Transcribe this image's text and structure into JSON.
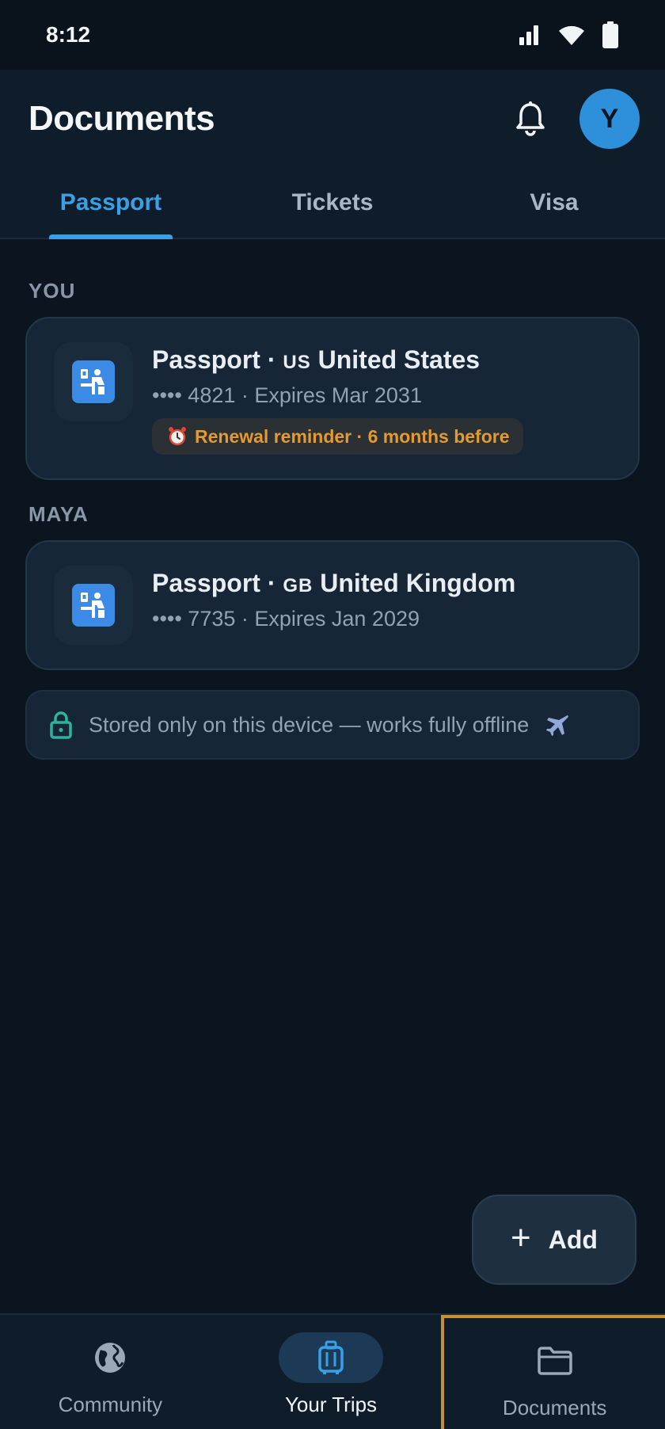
{
  "status_bar": {
    "time": "8:12",
    "icons": [
      "signal-icon",
      "wifi-icon",
      "battery-icon"
    ]
  },
  "header": {
    "title": "Documents",
    "notifications_icon": "bell-icon",
    "avatar_initial": "Y"
  },
  "tabs": [
    {
      "label": "Passport",
      "active": true
    },
    {
      "label": "Tickets",
      "active": false
    },
    {
      "label": "Visa",
      "active": false
    }
  ],
  "sections": [
    {
      "label": "YOU",
      "document": {
        "title_prefix": "Passport ·",
        "country_code": "US",
        "country": "United States",
        "subtitle": "•••• 4821 · Expires Mar 2031",
        "reminder": "Renewal reminder · 6 months before",
        "reminder_icon": "alarm-clock-icon"
      }
    },
    {
      "label": "MAYA",
      "document": {
        "title_prefix": "Passport ·",
        "country_code": "GB",
        "country": "United Kingdom",
        "subtitle": "•••• 7735 · Expires Jan 2029"
      }
    }
  ],
  "offline_note": {
    "icon": "lock-icon",
    "text": "Stored only on this device — works fully offline",
    "trailing_icon": "airplane-icon"
  },
  "fab": {
    "label": "Add",
    "icon": "plus-icon"
  },
  "bottom_nav": [
    {
      "label": "Community",
      "icon": "globe-icon",
      "active": false
    },
    {
      "label": "Your Trips",
      "icon": "luggage-icon",
      "active": true
    },
    {
      "label": "Documents",
      "icon": "folder-icon",
      "active": false
    }
  ],
  "colors": {
    "accent": "#3aa0e6",
    "reminder": "#e49a30",
    "offline_lock": "#2bb3a0",
    "highlight_border": "#c8902e"
  }
}
